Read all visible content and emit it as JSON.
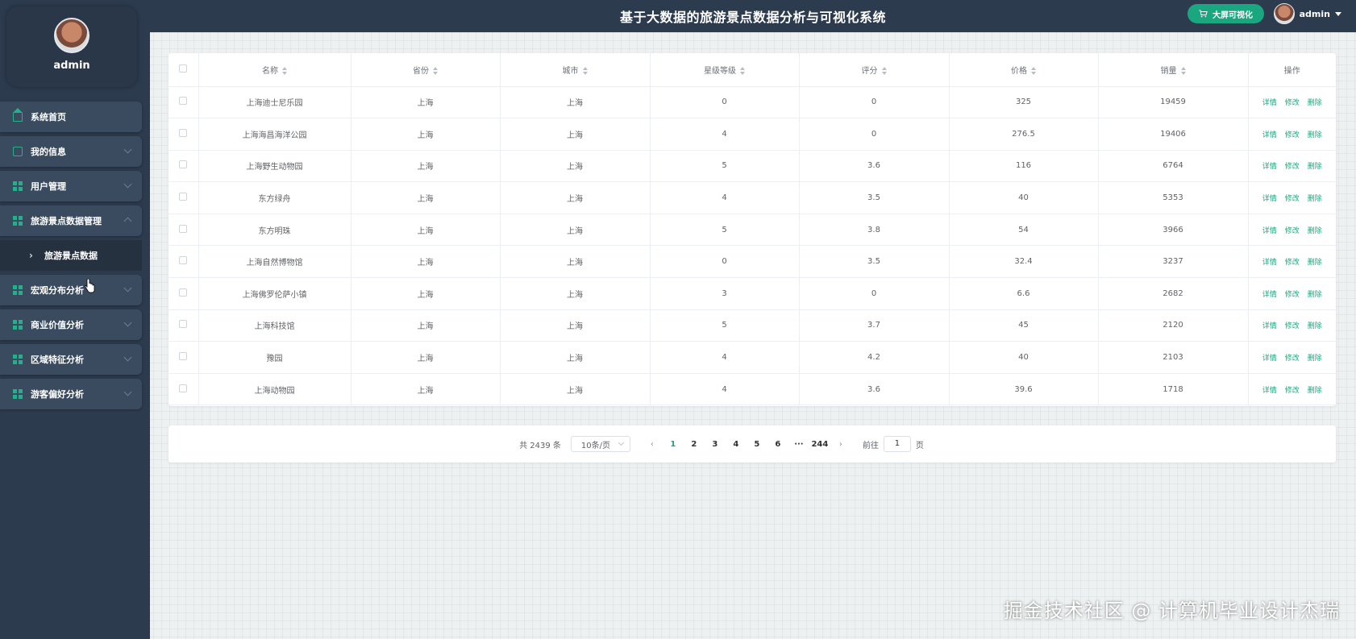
{
  "app": {
    "title": "基于大数据的旅游景点数据分析与可视化系统",
    "big_screen_label": "大屏可视化",
    "user_name": "admin"
  },
  "sidebar": {
    "profile_name": "admin",
    "items": [
      {
        "label": "系统首页",
        "icon": "home-icon"
      },
      {
        "label": "我的信息",
        "icon": "card-icon"
      },
      {
        "label": "用户管理",
        "icon": "grid-icon"
      },
      {
        "label": "旅游景点数据管理",
        "icon": "grid-icon"
      },
      {
        "label": "旅游景点数据",
        "icon": "chevron-right-icon"
      },
      {
        "label": "宏观分布分析",
        "icon": "grid-icon"
      },
      {
        "label": "商业价值分析",
        "icon": "grid-icon"
      },
      {
        "label": "区域特征分析",
        "icon": "grid-icon"
      },
      {
        "label": "游客偏好分析",
        "icon": "grid-icon"
      }
    ]
  },
  "table": {
    "headers": [
      "名称",
      "省份",
      "城市",
      "星级等级",
      "评分",
      "价格",
      "销量",
      "操作"
    ],
    "actions": {
      "detail": "详情",
      "edit": "修改",
      "delete": "删除"
    },
    "rows": [
      {
        "name": "上海迪士尼乐园",
        "province": "上海",
        "city": "上海",
        "star": "0",
        "score": "0",
        "price": "325",
        "sales": "19459"
      },
      {
        "name": "上海海昌海洋公园",
        "province": "上海",
        "city": "上海",
        "star": "4",
        "score": "0",
        "price": "276.5",
        "sales": "19406"
      },
      {
        "name": "上海野生动物园",
        "province": "上海",
        "city": "上海",
        "star": "5",
        "score": "3.6",
        "price": "116",
        "sales": "6764"
      },
      {
        "name": "东方绿舟",
        "province": "上海",
        "city": "上海",
        "star": "4",
        "score": "3.5",
        "price": "40",
        "sales": "5353"
      },
      {
        "name": "东方明珠",
        "province": "上海",
        "city": "上海",
        "star": "5",
        "score": "3.8",
        "price": "54",
        "sales": "3966"
      },
      {
        "name": "上海自然博物馆",
        "province": "上海",
        "city": "上海",
        "star": "0",
        "score": "3.5",
        "price": "32.4",
        "sales": "3237"
      },
      {
        "name": "上海佛罗伦萨小镇",
        "province": "上海",
        "city": "上海",
        "star": "3",
        "score": "0",
        "price": "6.6",
        "sales": "2682"
      },
      {
        "name": "上海科技馆",
        "province": "上海",
        "city": "上海",
        "star": "5",
        "score": "3.7",
        "price": "45",
        "sales": "2120"
      },
      {
        "name": "豫园",
        "province": "上海",
        "city": "上海",
        "star": "4",
        "score": "4.2",
        "price": "40",
        "sales": "2103"
      },
      {
        "name": "上海动物园",
        "province": "上海",
        "city": "上海",
        "star": "4",
        "score": "3.6",
        "price": "39.6",
        "sales": "1718"
      }
    ]
  },
  "pagination": {
    "total": "共 2439 条",
    "page_size": "10条/页",
    "pages": [
      "1",
      "2",
      "3",
      "4",
      "5",
      "6"
    ],
    "ellipsis": "···",
    "last_page": "244",
    "current": "1",
    "goto_prefix": "前往",
    "goto_value": "1",
    "goto_suffix": "页"
  },
  "watermark": "掘金技术社区 @ 计算机毕业设计杰瑞",
  "colors": {
    "accent": "#1aa67f",
    "sidebar_bg": "#2d3b4f"
  }
}
